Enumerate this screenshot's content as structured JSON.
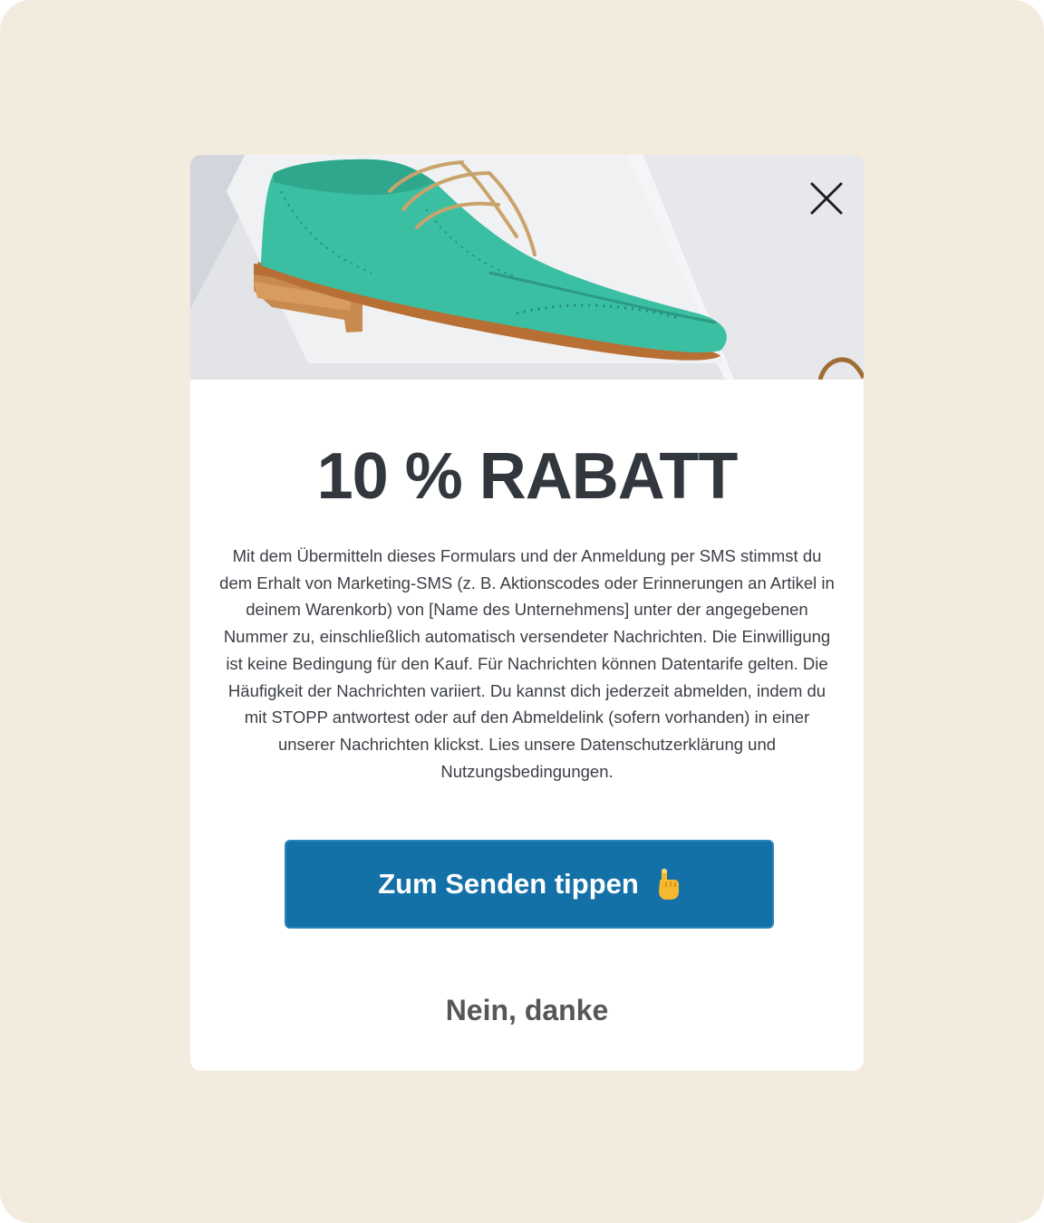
{
  "modal": {
    "hero_alt": "Teal brogue shoe",
    "close_icon": "close-icon",
    "title": "10 % RABATT",
    "disclaimer": "Mit dem Übermitteln dieses Formulars und der Anmeldung per SMS stimmst du dem Erhalt von Marketing-SMS (z. B. Aktionscodes oder Erinnerungen an Artikel in deinem Warenkorb) von [Name des Unternehmens] unter der angegebenen Nummer zu, einschließlich automatisch versendeter Nachrichten. Die Einwilligung ist keine Bedingung für den Kauf. Für Nachrichten können Datentarife gelten. Die Häufigkeit der Nachrichten variiert. Du kannst dich jederzeit abmelden, indem du mit STOPP antwortest oder auf den Abmeldelink (sofern vorhanden) in einer unserer Nachrichten klickst. Lies unsere Datenschutzerklärung und Nutzungsbedingungen.",
    "submit_label": "Zum Senden tippen",
    "submit_icon": "pointing-hand-icon",
    "decline_label": "Nein, danke"
  },
  "colors": {
    "page_background": "#f3ebdd",
    "modal_background": "#ffffff",
    "title": "#32373d",
    "button_primary": "#1471a7",
    "decline_text": "#575757",
    "shoe": "#3bbfa3"
  }
}
